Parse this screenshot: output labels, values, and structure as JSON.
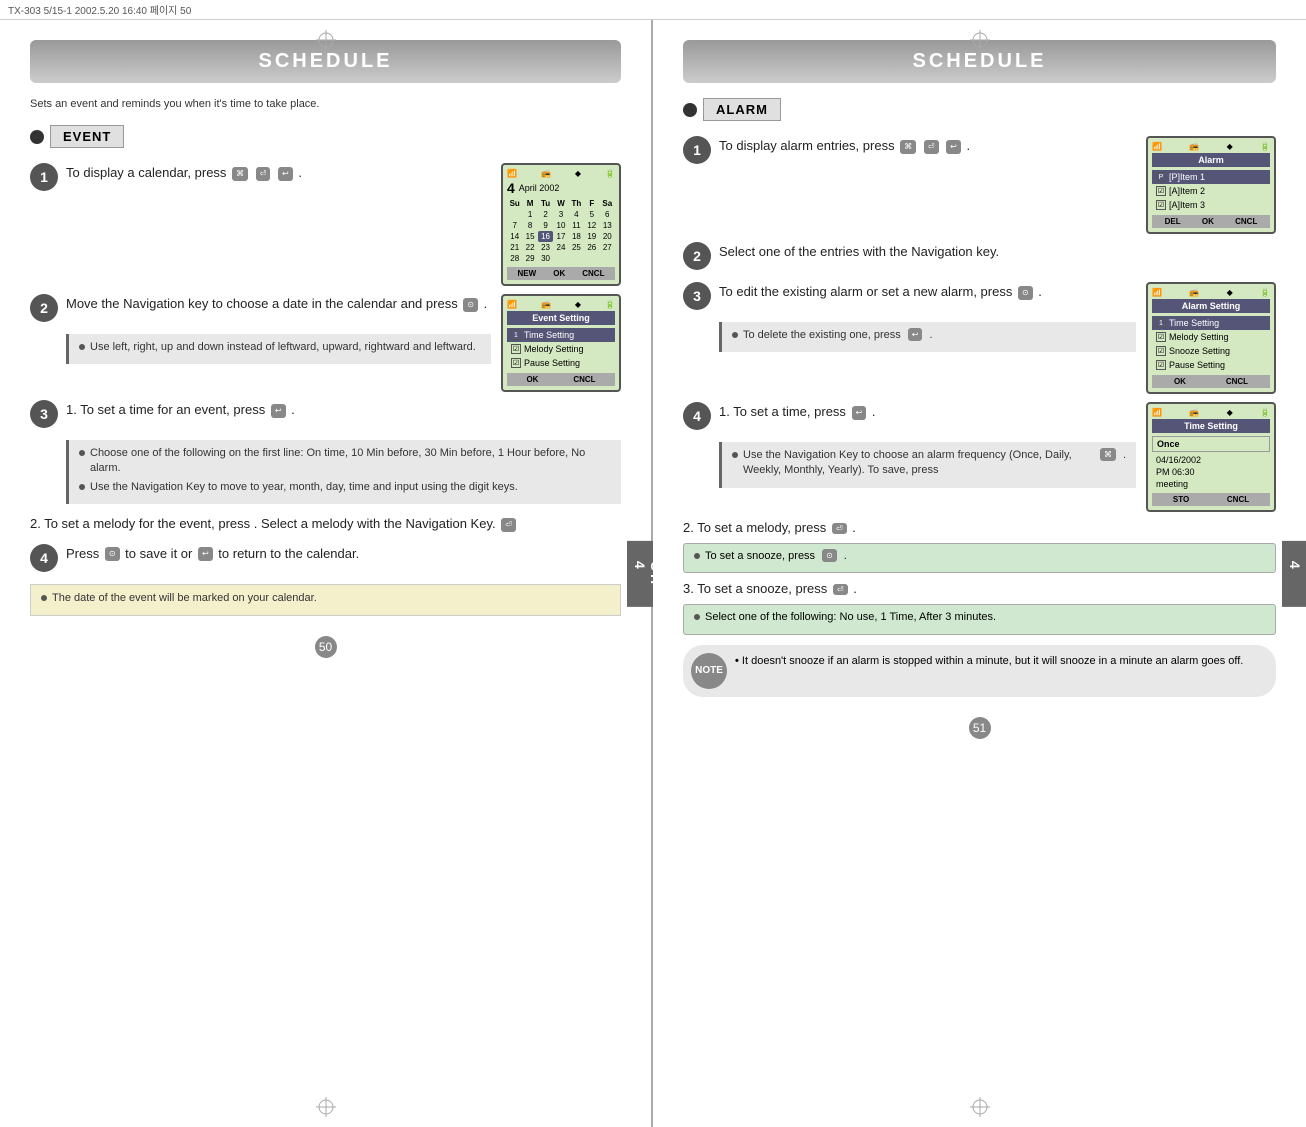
{
  "topbar": {
    "text": "TX-303 5/15-1  2002.5.20  16:40 페이지 50"
  },
  "left_page": {
    "header": "SCHEDULE",
    "subtitle": "Sets an event and reminds you when it's time to take place.",
    "section": {
      "label": "EVENT"
    },
    "steps": [
      {
        "number": "1",
        "text": "To display a calendar, press"
      },
      {
        "number": "2",
        "text": "Move the Navigation key to choose a date in the calendar and  press"
      },
      {
        "number": "3",
        "text": "1. To set a time for an event, press"
      },
      {
        "number": "4",
        "text": "Press      to save it or      to return to the calendar."
      }
    ],
    "note1": {
      "text": "Use left, right, up and down instead of leftward, upward, rightward and leftward."
    },
    "note2_bullets": [
      "Choose one of the following on the first line: On time, 10 Min before, 30 Min before, 1 Hour before, No alarm.",
      "Use the Navigation Key to move to year, month, day, time and input using the digit keys."
    ],
    "step_2_text": "2. To set a melody for the event, press      . Select a melody with the Navigation Key.",
    "note_final": "The date of the event will be marked on your calendar.",
    "calendar": {
      "month_year": "April  2002",
      "day_num": "4",
      "days": [
        "Su",
        "M",
        "Tu",
        "W",
        "Th",
        "F",
        "Sa"
      ],
      "weeks": [
        [
          "",
          "",
          "",
          "",
          "",
          "",
          "6"
        ],
        [
          "",
          "1",
          "2",
          "3",
          "4",
          "5",
          ""
        ],
        [
          "7",
          "8",
          "9",
          "10",
          "11",
          "12",
          "13"
        ],
        [
          "14",
          "15",
          "16",
          "17",
          "18",
          "19",
          "20"
        ],
        [
          "21",
          "22",
          "23",
          "24",
          "25",
          "26",
          "27"
        ],
        [
          "28",
          "29",
          "30",
          "",
          "",
          "",
          ""
        ]
      ],
      "today": "16",
      "buttons": [
        "NEW",
        "OK",
        "CNCL"
      ]
    },
    "event_setting": {
      "title": "Event Setting",
      "items": [
        {
          "icon": "1",
          "label": "Time Setting",
          "selected": true
        },
        {
          "icon": "2",
          "label": "Melody Setting",
          "selected": false
        },
        {
          "icon": "3",
          "label": "Pause Setting",
          "selected": false
        }
      ],
      "buttons": [
        "OK",
        "CNCL"
      ]
    },
    "page_number": "50",
    "side_tab": "CH\n4"
  },
  "right_page": {
    "header": "SCHEDULE",
    "section": {
      "label": "ALARM"
    },
    "steps": [
      {
        "number": "1",
        "text": "To display alarm entries, press"
      },
      {
        "number": "2",
        "text": "Select one of the entries with the Navigation key."
      },
      {
        "number": "3",
        "text": "To edit the existing alarm or set a new alarm, press"
      },
      {
        "number": "4",
        "text": "1. To set a time, press"
      }
    ],
    "step4_sub1": "Use the Navigation Key to choose an alarm frequency (Once, Daily, Weekly, Monthly, Yearly). To save, press",
    "step_melody": "2. To set a melody, press",
    "note_snooze_set": "To set a snooze, press",
    "step_snooze": "3. To set a snooze, press",
    "note_snooze_select": "Select one of the following: No use, 1 Time, After 3 minutes.",
    "note_delete": "To delete the existing one, press",
    "alarm_screen": {
      "title": "Alarm",
      "items": [
        {
          "icon": "P",
          "label": "Item 1",
          "selected": true
        },
        {
          "icon": "A",
          "label": "Item 2",
          "selected": false
        },
        {
          "icon": "A",
          "label": "Item 3",
          "selected": false
        }
      ],
      "buttons": [
        "DEL",
        "OK",
        "CNCL"
      ]
    },
    "alarm_setting_screen": {
      "title": "Alarm Setting",
      "items": [
        {
          "icon": "1",
          "label": "Time Setting",
          "selected": true
        },
        {
          "icon": "2",
          "label": "Melody Setting",
          "selected": false
        },
        {
          "icon": "3",
          "label": "Snooze Setting",
          "selected": false
        },
        {
          "icon": "4",
          "label": "Pause Setting",
          "selected": false
        }
      ],
      "buttons": [
        "OK",
        "CNCL"
      ]
    },
    "time_setting_screen": {
      "title": "Time Setting",
      "once": "Once",
      "date": "04/16/2002",
      "time": "PM 06:30",
      "label": "meeting",
      "buttons": [
        "STO",
        "CNCL"
      ]
    },
    "final_note": {
      "text": "It doesn't snooze if an alarm is stopped within a minute, but it will snooze in a minute an alarm goes off."
    },
    "page_number": "51",
    "side_tab": "CH\n4"
  }
}
